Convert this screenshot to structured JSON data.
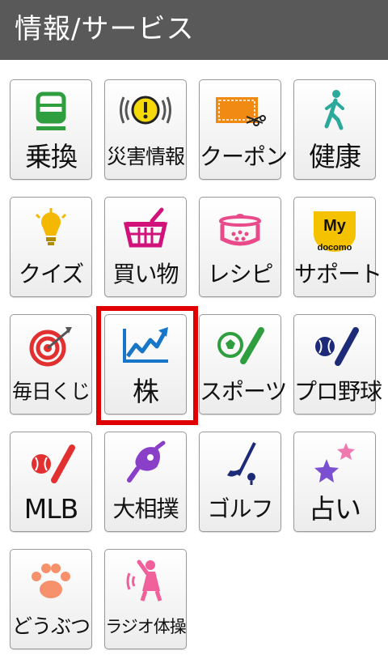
{
  "header": {
    "title": "情報/サービス"
  },
  "tiles": [
    {
      "label": "乗換",
      "icon": "train-icon"
    },
    {
      "label": "災害情報",
      "icon": "alert-icon"
    },
    {
      "label": "クーポン",
      "icon": "coupon-icon"
    },
    {
      "label": "健康",
      "icon": "walking-person-icon"
    },
    {
      "label": "クイズ",
      "icon": "lightbulb-icon"
    },
    {
      "label": "買い物",
      "icon": "shopping-basket-icon"
    },
    {
      "label": "レシピ",
      "icon": "cooking-pot-icon"
    },
    {
      "label": "サポート",
      "icon": "my-docomo-icon",
      "icon_text": "My",
      "icon_subtext": "docomo"
    },
    {
      "label": "毎日くじ",
      "icon": "target-icon"
    },
    {
      "label": "株",
      "icon": "stock-chart-icon"
    },
    {
      "label": "スポーツ",
      "icon": "soccer-baseball-icon"
    },
    {
      "label": "プロ野球",
      "icon": "baseball-icon"
    },
    {
      "label": "MLB",
      "icon": "mlb-baseball-icon"
    },
    {
      "label": "大相撲",
      "icon": "sumo-icon"
    },
    {
      "label": "ゴルフ",
      "icon": "golf-icon"
    },
    {
      "label": "占い",
      "icon": "stars-icon"
    },
    {
      "label": "どうぶつ",
      "icon": "paw-icon"
    },
    {
      "label": "ラジオ体操",
      "icon": "radio-exercise-icon"
    }
  ],
  "selected_tile": "株",
  "colors": {
    "header_bg": "#595959",
    "highlight": "#e00000",
    "green": "#2e9e3e",
    "orange": "#f08a12",
    "magenta": "#d0127a",
    "purple": "#8a3fc8",
    "navy": "#1d2a78",
    "blue": "#1776c8",
    "red": "#e23030",
    "pink": "#f0609a"
  }
}
